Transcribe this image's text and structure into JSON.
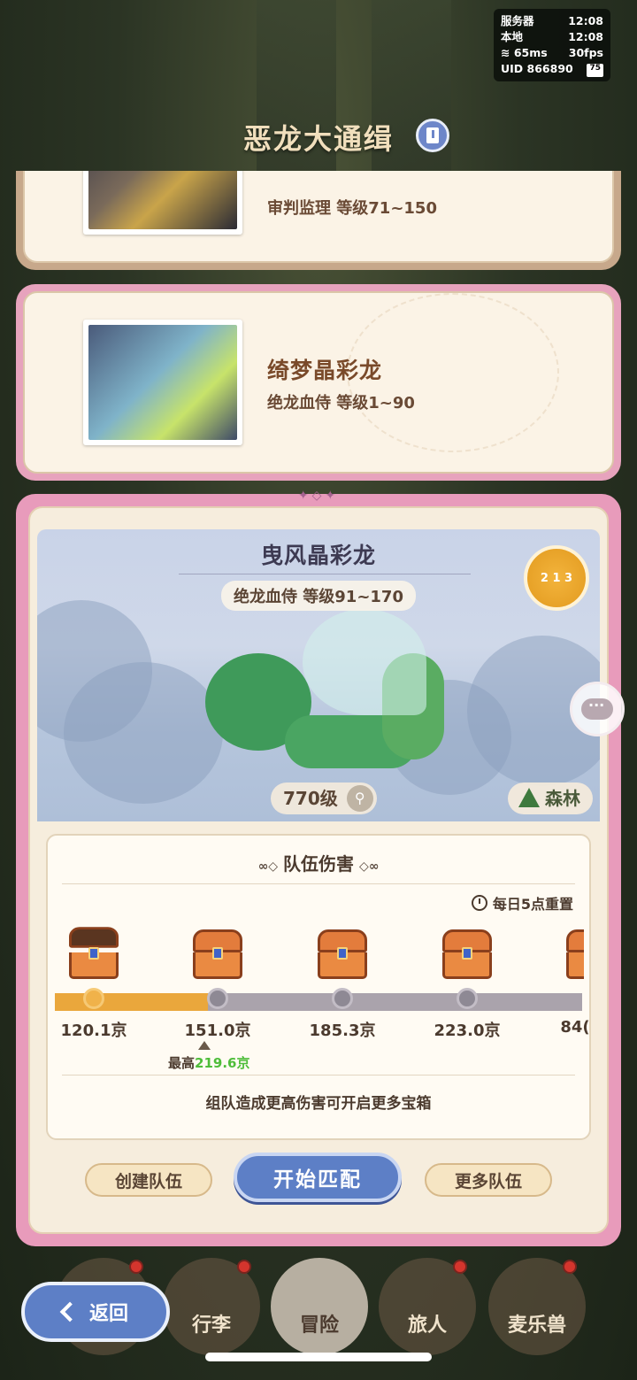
{
  "status": {
    "server_label": "服务器",
    "server_time": "12:08",
    "local_label": "本地",
    "local_time": "12:08",
    "ping": "65ms",
    "fps": "30fps",
    "uid": "UID 866890",
    "battery": "75"
  },
  "header": {
    "title": "恶龙大通缉"
  },
  "dragons": [
    {
      "name": "",
      "subtitle": "审判监理  等级71~150"
    },
    {
      "name": "绮梦晶彩龙",
      "subtitle": "绝龙血侍  等级1~90"
    }
  ],
  "featured": {
    "name": "曳风晶彩龙",
    "subtitle": "绝龙血侍  等级91~170",
    "rank_badge": "2 1 3",
    "level": "770级",
    "biome": "森林",
    "team_damage_title": "队伍伤害",
    "reset_text": "每日5点重置",
    "milestones": [
      "120.1京",
      "151.0京",
      "185.3京",
      "223.0京",
      "84("
    ],
    "progress_fraction": 0.29,
    "best_label": "最高",
    "best_value": "219.6京",
    "hint": "组队造成更高伤害可开启更多宝箱"
  },
  "actions": {
    "create_team": "创建队伍",
    "start_match": "开始匹配",
    "more_teams": "更多队伍"
  },
  "nav": {
    "back": "返回",
    "items": [
      "行李",
      "冒险",
      "旅人",
      "麦乐兽"
    ]
  },
  "colors": {
    "accent_blue": "#5d7fc6",
    "card_pink": "#e89bbb",
    "progress_orange": "#eaa73c",
    "best_green": "#4ebd3a"
  }
}
